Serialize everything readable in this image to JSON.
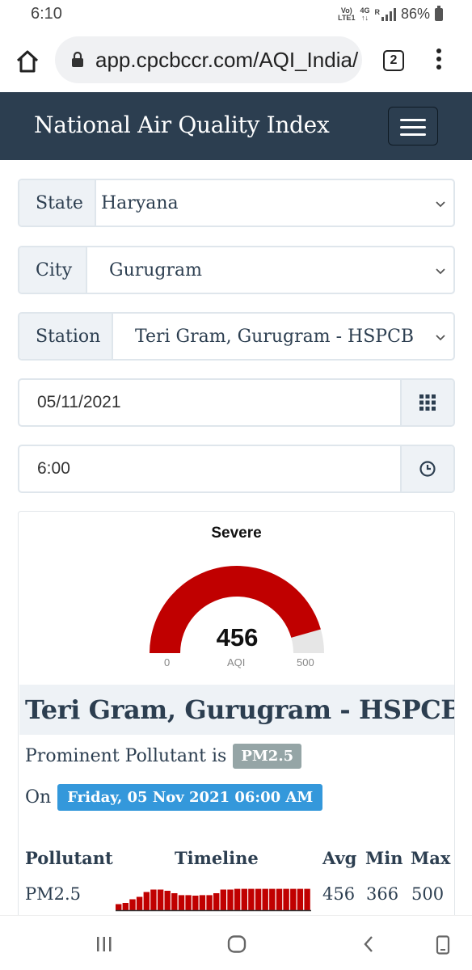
{
  "status_bar": {
    "time": "6:10",
    "net1": "Vo)\nLTE1",
    "net2": "4G\n↑↓",
    "net3": "R",
    "battery": "86%"
  },
  "browser": {
    "url": "app.cpcbccr.com/AQI_India/",
    "tab_count": "2"
  },
  "nav": {
    "title": "National Air Quality Index"
  },
  "form": {
    "state_label": "State",
    "state_value": "Haryana",
    "city_label": "City",
    "city_value": "Gurugram",
    "station_label": "Station",
    "station_value": "Teri Gram, Gurugram - HSPCB",
    "date_value": "05/11/2021",
    "time_value": "6:00"
  },
  "gauge": {
    "category": "Severe",
    "value": "456",
    "value_num": 456,
    "min": "0",
    "max": "500",
    "label": "AQI",
    "fill_color": "#c00000",
    "track_color": "#e6e6e6"
  },
  "station": {
    "title": "Teri Gram, Gurugram - HSPCB",
    "prominent_prefix": "Prominent Pollutant is",
    "prominent_badge": "PM2.5",
    "on_prefix": "On",
    "datetime_badge": "Friday, 05 Nov 2021 06:00 AM"
  },
  "table": {
    "headers": [
      "Pollutant",
      "Timeline",
      "Avg",
      "Min",
      "Max"
    ],
    "rows": [
      {
        "pollutant": "PM2.5",
        "avg": "456",
        "min": "366",
        "max": "500",
        "timeline": [
          0.25,
          0.3,
          0.45,
          0.55,
          0.75,
          0.85,
          0.85,
          0.8,
          0.7,
          0.62,
          0.62,
          0.6,
          0.62,
          0.62,
          0.7,
          0.85,
          0.85,
          0.88,
          0.88,
          0.88,
          0.88,
          0.88,
          0.88,
          0.88,
          0.88,
          0.88,
          0.88,
          0.88
        ],
        "timeline_color": "#c00000"
      }
    ]
  }
}
